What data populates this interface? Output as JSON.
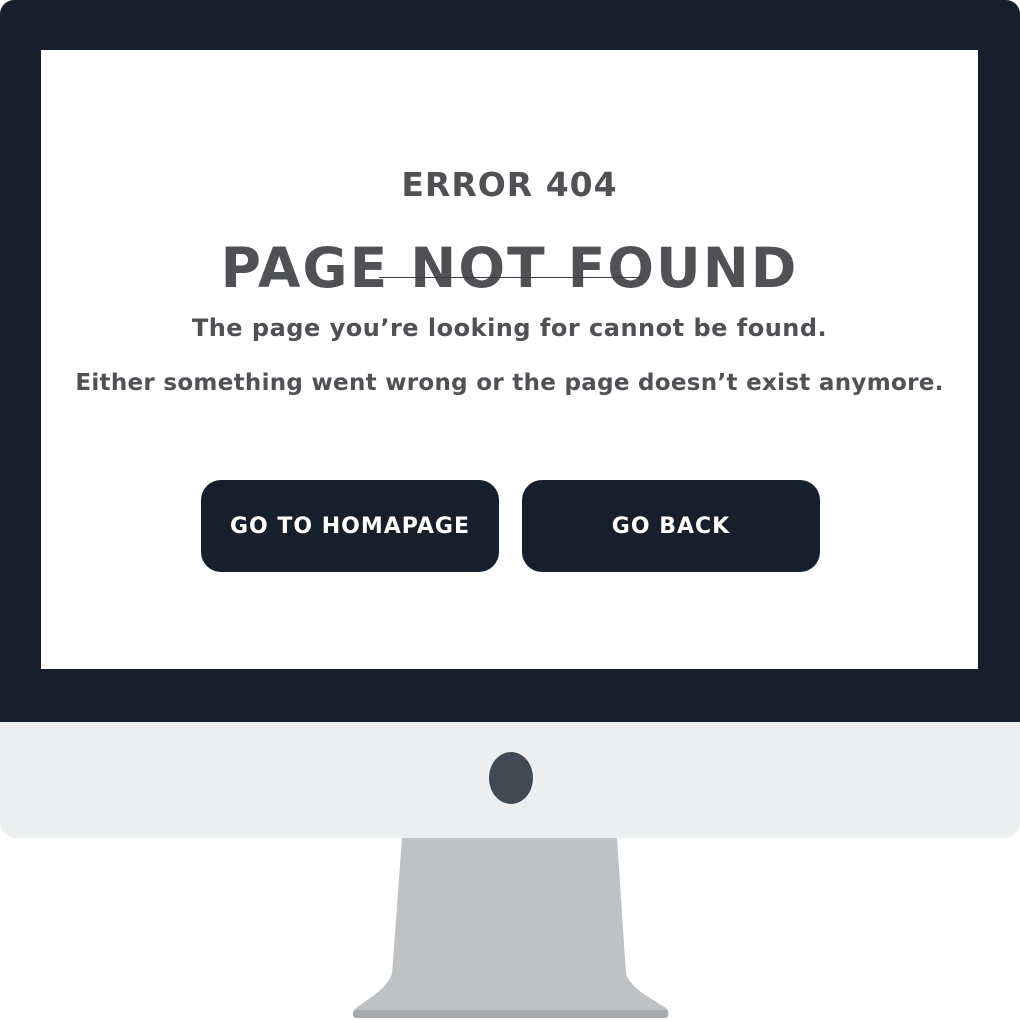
{
  "error_page": {
    "error_code": "ERROR 404",
    "title": "PAGE NOT FOUND",
    "message_line_1": "The page you’re looking for cannot be found.",
    "message_line_2": "Either something went wrong or the page doesn’t exist anymore.",
    "buttons": {
      "homepage_label": "GO TO HOMAPAGE",
      "back_label": "GO BACK"
    }
  },
  "colors": {
    "bezel": "#16202c",
    "text": "#4f5155",
    "chin": "#ebeff0",
    "stand": "#bec2c5",
    "camera": "#3f4a52"
  },
  "icons": {
    "camera": "camera-icon"
  }
}
